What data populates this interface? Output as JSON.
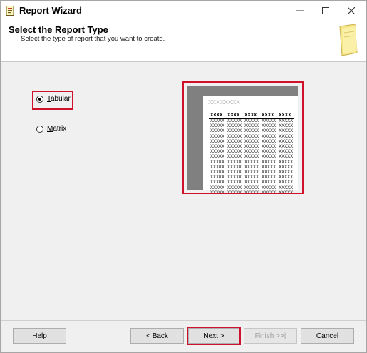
{
  "window": {
    "title": "Report Wizard"
  },
  "header": {
    "title": "Select the Report Type",
    "subtitle": "Select the type of report that you want to create."
  },
  "options": [
    {
      "label_first": "T",
      "label_rest": "abular",
      "selected": true
    },
    {
      "label_first": "M",
      "label_rest": "atrix",
      "selected": false
    }
  ],
  "preview": {
    "title": "XXXXXXXX",
    "headers": [
      "XXXX",
      "XXXX",
      "XXXX",
      "XXXX",
      "XXXX"
    ],
    "cell": "XXXXX",
    "row_count": 15
  },
  "buttons": {
    "help": {
      "first": "H",
      "rest": "elp"
    },
    "back": {
      "prefix": "< ",
      "first": "B",
      "rest": "ack"
    },
    "next": {
      "first": "N",
      "rest": "ext >"
    },
    "finish": "Finish >>|",
    "cancel": "Cancel"
  },
  "colors": {
    "highlight": "#d0112b",
    "preview_gray": "#808080"
  }
}
